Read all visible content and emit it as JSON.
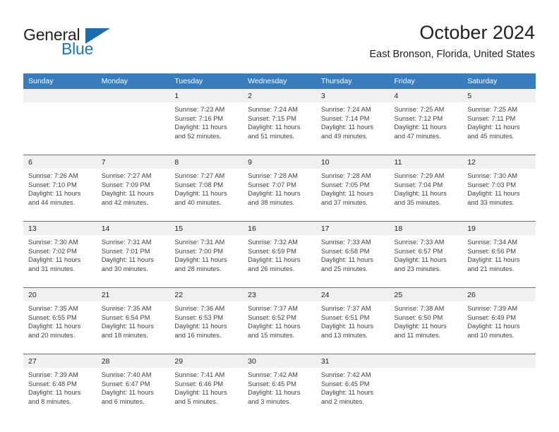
{
  "brand": {
    "word1": "General",
    "word2": "Blue",
    "logo_icon": "blue-triangle-icon"
  },
  "header": {
    "title": "October 2024",
    "subtitle": "East Bronson, Florida, United States"
  },
  "colors": {
    "header_blue": "#3a7dbf",
    "logo_blue": "#1b75bb",
    "daynum_band": "#f0f0f0",
    "text": "#231f20",
    "body_text": "#404040"
  },
  "calendar": {
    "day_headers": [
      "Sunday",
      "Monday",
      "Tuesday",
      "Wednesday",
      "Thursday",
      "Friday",
      "Saturday"
    ],
    "weeks": [
      [
        {
          "day": "",
          "sunrise": "",
          "sunset": "",
          "daylight1": "",
          "daylight2": "",
          "empty": true
        },
        {
          "day": "",
          "sunrise": "",
          "sunset": "",
          "daylight1": "",
          "daylight2": "",
          "empty": true
        },
        {
          "day": "1",
          "sunrise": "Sunrise: 7:23 AM",
          "sunset": "Sunset: 7:16 PM",
          "daylight1": "Daylight: 11 hours",
          "daylight2": "and 52 minutes.",
          "empty": false
        },
        {
          "day": "2",
          "sunrise": "Sunrise: 7:24 AM",
          "sunset": "Sunset: 7:15 PM",
          "daylight1": "Daylight: 11 hours",
          "daylight2": "and 51 minutes.",
          "empty": false
        },
        {
          "day": "3",
          "sunrise": "Sunrise: 7:24 AM",
          "sunset": "Sunset: 7:14 PM",
          "daylight1": "Daylight: 11 hours",
          "daylight2": "and 49 minutes.",
          "empty": false
        },
        {
          "day": "4",
          "sunrise": "Sunrise: 7:25 AM",
          "sunset": "Sunset: 7:12 PM",
          "daylight1": "Daylight: 11 hours",
          "daylight2": "and 47 minutes.",
          "empty": false
        },
        {
          "day": "5",
          "sunrise": "Sunrise: 7:25 AM",
          "sunset": "Sunset: 7:11 PM",
          "daylight1": "Daylight: 11 hours",
          "daylight2": "and 45 minutes.",
          "empty": false
        }
      ],
      [
        {
          "day": "6",
          "sunrise": "Sunrise: 7:26 AM",
          "sunset": "Sunset: 7:10 PM",
          "daylight1": "Daylight: 11 hours",
          "daylight2": "and 44 minutes.",
          "empty": false
        },
        {
          "day": "7",
          "sunrise": "Sunrise: 7:27 AM",
          "sunset": "Sunset: 7:09 PM",
          "daylight1": "Daylight: 11 hours",
          "daylight2": "and 42 minutes.",
          "empty": false
        },
        {
          "day": "8",
          "sunrise": "Sunrise: 7:27 AM",
          "sunset": "Sunset: 7:08 PM",
          "daylight1": "Daylight: 11 hours",
          "daylight2": "and 40 minutes.",
          "empty": false
        },
        {
          "day": "9",
          "sunrise": "Sunrise: 7:28 AM",
          "sunset": "Sunset: 7:07 PM",
          "daylight1": "Daylight: 11 hours",
          "daylight2": "and 38 minutes.",
          "empty": false
        },
        {
          "day": "10",
          "sunrise": "Sunrise: 7:28 AM",
          "sunset": "Sunset: 7:05 PM",
          "daylight1": "Daylight: 11 hours",
          "daylight2": "and 37 minutes.",
          "empty": false
        },
        {
          "day": "11",
          "sunrise": "Sunrise: 7:29 AM",
          "sunset": "Sunset: 7:04 PM",
          "daylight1": "Daylight: 11 hours",
          "daylight2": "and 35 minutes.",
          "empty": false
        },
        {
          "day": "12",
          "sunrise": "Sunrise: 7:30 AM",
          "sunset": "Sunset: 7:03 PM",
          "daylight1": "Daylight: 11 hours",
          "daylight2": "and 33 minutes.",
          "empty": false
        }
      ],
      [
        {
          "day": "13",
          "sunrise": "Sunrise: 7:30 AM",
          "sunset": "Sunset: 7:02 PM",
          "daylight1": "Daylight: 11 hours",
          "daylight2": "and 31 minutes.",
          "empty": false
        },
        {
          "day": "14",
          "sunrise": "Sunrise: 7:31 AM",
          "sunset": "Sunset: 7:01 PM",
          "daylight1": "Daylight: 11 hours",
          "daylight2": "and 30 minutes.",
          "empty": false
        },
        {
          "day": "15",
          "sunrise": "Sunrise: 7:31 AM",
          "sunset": "Sunset: 7:00 PM",
          "daylight1": "Daylight: 11 hours",
          "daylight2": "and 28 minutes.",
          "empty": false
        },
        {
          "day": "16",
          "sunrise": "Sunrise: 7:32 AM",
          "sunset": "Sunset: 6:59 PM",
          "daylight1": "Daylight: 11 hours",
          "daylight2": "and 26 minutes.",
          "empty": false
        },
        {
          "day": "17",
          "sunrise": "Sunrise: 7:33 AM",
          "sunset": "Sunset: 6:58 PM",
          "daylight1": "Daylight: 11 hours",
          "daylight2": "and 25 minutes.",
          "empty": false
        },
        {
          "day": "18",
          "sunrise": "Sunrise: 7:33 AM",
          "sunset": "Sunset: 6:57 PM",
          "daylight1": "Daylight: 11 hours",
          "daylight2": "and 23 minutes.",
          "empty": false
        },
        {
          "day": "19",
          "sunrise": "Sunrise: 7:34 AM",
          "sunset": "Sunset: 6:56 PM",
          "daylight1": "Daylight: 11 hours",
          "daylight2": "and 21 minutes.",
          "empty": false
        }
      ],
      [
        {
          "day": "20",
          "sunrise": "Sunrise: 7:35 AM",
          "sunset": "Sunset: 6:55 PM",
          "daylight1": "Daylight: 11 hours",
          "daylight2": "and 20 minutes.",
          "empty": false
        },
        {
          "day": "21",
          "sunrise": "Sunrise: 7:35 AM",
          "sunset": "Sunset: 6:54 PM",
          "daylight1": "Daylight: 11 hours",
          "daylight2": "and 18 minutes.",
          "empty": false
        },
        {
          "day": "22",
          "sunrise": "Sunrise: 7:36 AM",
          "sunset": "Sunset: 6:53 PM",
          "daylight1": "Daylight: 11 hours",
          "daylight2": "and 16 minutes.",
          "empty": false
        },
        {
          "day": "23",
          "sunrise": "Sunrise: 7:37 AM",
          "sunset": "Sunset: 6:52 PM",
          "daylight1": "Daylight: 11 hours",
          "daylight2": "and 15 minutes.",
          "empty": false
        },
        {
          "day": "24",
          "sunrise": "Sunrise: 7:37 AM",
          "sunset": "Sunset: 6:51 PM",
          "daylight1": "Daylight: 11 hours",
          "daylight2": "and 13 minutes.",
          "empty": false
        },
        {
          "day": "25",
          "sunrise": "Sunrise: 7:38 AM",
          "sunset": "Sunset: 6:50 PM",
          "daylight1": "Daylight: 11 hours",
          "daylight2": "and 11 minutes.",
          "empty": false
        },
        {
          "day": "26",
          "sunrise": "Sunrise: 7:39 AM",
          "sunset": "Sunset: 6:49 PM",
          "daylight1": "Daylight: 11 hours",
          "daylight2": "and 10 minutes.",
          "empty": false
        }
      ],
      [
        {
          "day": "27",
          "sunrise": "Sunrise: 7:39 AM",
          "sunset": "Sunset: 6:48 PM",
          "daylight1": "Daylight: 11 hours",
          "daylight2": "and 8 minutes.",
          "empty": false
        },
        {
          "day": "28",
          "sunrise": "Sunrise: 7:40 AM",
          "sunset": "Sunset: 6:47 PM",
          "daylight1": "Daylight: 11 hours",
          "daylight2": "and 6 minutes.",
          "empty": false
        },
        {
          "day": "29",
          "sunrise": "Sunrise: 7:41 AM",
          "sunset": "Sunset: 6:46 PM",
          "daylight1": "Daylight: 11 hours",
          "daylight2": "and 5 minutes.",
          "empty": false
        },
        {
          "day": "30",
          "sunrise": "Sunrise: 7:42 AM",
          "sunset": "Sunset: 6:45 PM",
          "daylight1": "Daylight: 11 hours",
          "daylight2": "and 3 minutes.",
          "empty": false
        },
        {
          "day": "31",
          "sunrise": "Sunrise: 7:42 AM",
          "sunset": "Sunset: 6:45 PM",
          "daylight1": "Daylight: 11 hours",
          "daylight2": "and 2 minutes.",
          "empty": false
        },
        {
          "day": "",
          "sunrise": "",
          "sunset": "",
          "daylight1": "",
          "daylight2": "",
          "empty": true
        },
        {
          "day": "",
          "sunrise": "",
          "sunset": "",
          "daylight1": "",
          "daylight2": "",
          "empty": true
        }
      ]
    ]
  }
}
